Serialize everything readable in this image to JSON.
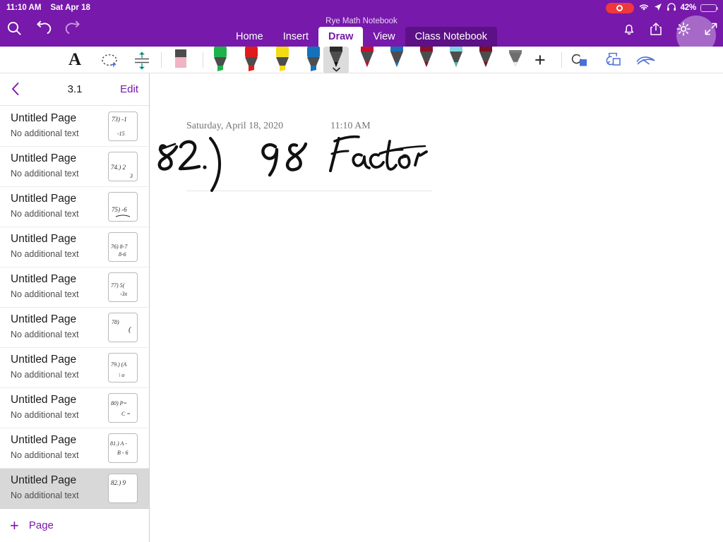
{
  "status_bar": {
    "time": "11:10 AM",
    "date": "Sat Apr 18",
    "battery_percent": "42%",
    "battery_level": 42,
    "icons": [
      "screen-record-icon",
      "wifi-icon",
      "location-icon",
      "headphones-icon"
    ],
    "accent_color": "#7719aa",
    "record_color": "#f0383c"
  },
  "ribbon": {
    "document_title": "Rye Math Notebook",
    "left_icons": [
      "search-icon",
      "undo-icon",
      "redo-icon"
    ],
    "right_icons": [
      "notification-bell-icon",
      "share-icon",
      "settings-gear-icon",
      "fullscreen-expand-icon"
    ],
    "tabs": [
      {
        "label": "Home",
        "state": "normal"
      },
      {
        "label": "Insert",
        "state": "normal"
      },
      {
        "label": "Draw",
        "state": "active"
      },
      {
        "label": "View",
        "state": "normal"
      },
      {
        "label": "Class Notebook",
        "state": "highlight"
      }
    ]
  },
  "toolbar": {
    "text_tool_label": "A",
    "lasso_tool": "lasso-select-icon",
    "space_tool": "insert-space-icon",
    "add_pen_label": "+",
    "eraser": {
      "name": "eraser-tool",
      "body_color": "#f0b4c4",
      "top_color": "#4c4c4c"
    },
    "pens": [
      {
        "name": "highlighter-green",
        "color": "#1fb24a",
        "type": "highlighter",
        "selected": false
      },
      {
        "name": "highlighter-red",
        "color": "#e01b1b",
        "type": "highlighter",
        "selected": false
      },
      {
        "name": "highlighter-yellow",
        "color": "#f2dc14",
        "type": "highlighter",
        "selected": false
      },
      {
        "name": "highlighter-blue",
        "color": "#1472bb",
        "type": "highlighter",
        "selected": false
      },
      {
        "name": "pen-black",
        "color": "#1a1a1a",
        "type": "pen",
        "selected": true
      },
      {
        "name": "pen-red",
        "color": "#c8102e",
        "type": "pen",
        "selected": false
      },
      {
        "name": "pen-blue",
        "color": "#1c6fb5",
        "type": "pen",
        "selected": false
      },
      {
        "name": "pen-dark-red",
        "color": "#8c1127",
        "type": "pen",
        "selected": false
      },
      {
        "name": "pen-teal",
        "color": "#4fb8a8",
        "type": "pen",
        "selected": false
      },
      {
        "name": "pen-maroon",
        "color": "#7d0f22",
        "type": "pen",
        "selected": false
      },
      {
        "name": "pen-white",
        "color": "#f2f2f2",
        "type": "pen",
        "selected": false
      }
    ],
    "ink_tools": [
      "ink-to-shape-icon",
      "ink-replay-icon",
      "ink-to-text-icon"
    ],
    "ink_tool_color": "#4a6fd4"
  },
  "sidebar": {
    "section_title": "3.1",
    "back_label": "back-chevron",
    "edit_label": "Edit",
    "add_page_label": "Page",
    "add_page_plus": "+",
    "accent_color": "#7719aa",
    "pages": [
      {
        "title": "Untitled Page",
        "subtitle": "No additional text",
        "thumb_line1": "73) -1",
        "thumb_line2": "-15",
        "selected": false
      },
      {
        "title": "Untitled Page",
        "subtitle": "No additional text",
        "thumb_line1": "74.) 2",
        "thumb_line2": "3",
        "selected": false
      },
      {
        "title": "Untitled Page",
        "subtitle": "No additional text",
        "thumb_line1": "75) -6",
        "thumb_line2": "",
        "selected": false
      },
      {
        "title": "Untitled Page",
        "subtitle": "No additional text",
        "thumb_line1": "76) 8-7",
        "thumb_line2": "8-6",
        "selected": false
      },
      {
        "title": "Untitled Page",
        "subtitle": "No additional text",
        "thumb_line1": "77) 5(",
        "thumb_line2": "-3x",
        "selected": false
      },
      {
        "title": "Untitled Page",
        "subtitle": "No additional text",
        "thumb_line1": "78)",
        "thumb_line2": "(",
        "selected": false
      },
      {
        "title": "Untitled Page",
        "subtitle": "No additional text",
        "thumb_line1": "79.) (A",
        "thumb_line2": "\\ o",
        "selected": false
      },
      {
        "title": "Untitled Page",
        "subtitle": "No additional text",
        "thumb_line1": "80) P=",
        "thumb_line2": "C =",
        "selected": false
      },
      {
        "title": "Untitled Page",
        "subtitle": "No additional text",
        "thumb_line1": "81.) A -",
        "thumb_line2": "B - 6",
        "selected": false
      },
      {
        "title": "Untitled Page",
        "subtitle": "No additional text",
        "thumb_line1": "82.)  9",
        "thumb_line2": "",
        "selected": true
      }
    ]
  },
  "canvas": {
    "page_date": "Saturday, April 18, 2020",
    "page_time": "11:10 AM",
    "handwriting": "82.)   98   Factor",
    "ink_color": "#111111"
  }
}
